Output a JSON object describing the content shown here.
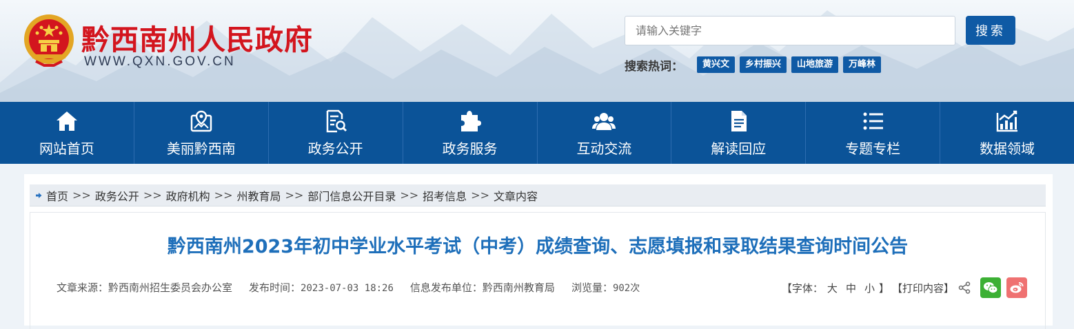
{
  "header": {
    "title": "黔西南州人民政府",
    "url": "WWW.QXN.GOV.CN",
    "search": {
      "placeholder": "请输入关键字",
      "button": "搜索"
    },
    "hot_label": "搜索热词：",
    "hot_tags": [
      "黄兴文",
      "乡村振兴",
      "山地旅游",
      "万峰林"
    ]
  },
  "nav": [
    {
      "label": "网站首页",
      "icon": "home-icon"
    },
    {
      "label": "美丽黔西南",
      "icon": "map-pin-icon"
    },
    {
      "label": "政务公开",
      "icon": "document-search-icon"
    },
    {
      "label": "政务服务",
      "icon": "puzzle-icon"
    },
    {
      "label": "互动交流",
      "icon": "users-icon"
    },
    {
      "label": "解读回应",
      "icon": "file-icon"
    },
    {
      "label": "专题专栏",
      "icon": "list-icon"
    },
    {
      "label": "数据领域",
      "icon": "chart-icon"
    }
  ],
  "breadcrumb": [
    "首页",
    "政务公开",
    "政府机构",
    "州教育局",
    "部门信息公开目录",
    "招考信息",
    "文章内容"
  ],
  "breadcrumb_sep": ">>",
  "article": {
    "title": "黔西南州2023年初中学业水平考试（中考）成绩查询、志愿填报和录取结果查询时间公告",
    "source_label": "文章来源：",
    "source": "黔西南州招生委员会办公室",
    "time_label": "发布时间：",
    "time": "2023-07-03 18:26",
    "publisher_label": "信息发布单位：",
    "publisher": "黔西南州教育局",
    "views_label": "浏览量：",
    "views": "902次"
  },
  "tools": {
    "font_label": "【字体：",
    "font_large": "大",
    "font_medium": "中",
    "font_small": "小",
    "font_close": "】",
    "print": "【打印内容】"
  },
  "colors": {
    "nav_bg": "#0b5398",
    "brand_red": "#d3151e",
    "title_blue": "#1e6fba",
    "button_blue": "#0f5aa5",
    "wechat_green": "#3cb034",
    "weibo_red": "#ef7171"
  }
}
